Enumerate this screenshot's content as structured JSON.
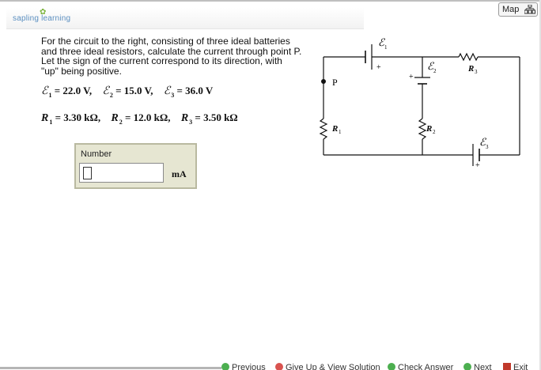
{
  "header": {
    "logo_text": "sapling learning",
    "map_label": "Map"
  },
  "question": {
    "text": "For the circuit to the right, consisting of three ideal batteries and three ideal resistors, calculate the current through point P. Let the sign of the current correspond to its direction, with \"up\" being positive."
  },
  "givens": {
    "emf": [
      {
        "symbol": "ℰ",
        "sub": "1",
        "value": "= 22.0  V,"
      },
      {
        "symbol": "ℰ",
        "sub": "2",
        "value": "= 15.0  V,"
      },
      {
        "symbol": "ℰ",
        "sub": "3",
        "value": "= 36.0  V"
      }
    ],
    "resistors": [
      {
        "symbol": "R",
        "sub": "1",
        "value": "= 3.30  kΩ,"
      },
      {
        "symbol": "R",
        "sub": "2",
        "value": "= 12.0  kΩ,"
      },
      {
        "symbol": "R",
        "sub": "3",
        "value": "= 3.50  kΩ"
      }
    ]
  },
  "answer": {
    "label": "Number",
    "value": "",
    "unit": "mA"
  },
  "circuit": {
    "point_label": "P",
    "r1": "R",
    "r1_sub": "1",
    "r2": "R",
    "r2_sub": "2",
    "r3": "R",
    "r3_sub": "3",
    "e1": "ℰ",
    "e1_sub": "1",
    "e2": "ℰ",
    "e2_sub": "2",
    "e3": "ℰ",
    "e3_sub": "3",
    "plus": "+"
  },
  "footer": {
    "previous": "Previous",
    "give_up": "Give Up & View Solution",
    "check": "Check Answer",
    "next": "Next",
    "exit": "Exit"
  }
}
